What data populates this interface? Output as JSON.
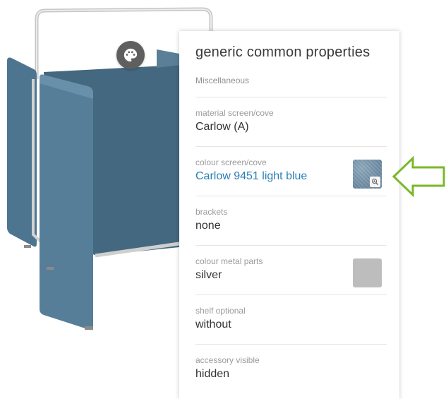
{
  "panel": {
    "title": "generic common properties",
    "section": "Miscellaneous",
    "properties": [
      {
        "label": "material screen/cove",
        "value": "Carlow (A)"
      },
      {
        "label": "colour screen/cove",
        "value": "Carlow 9451 light blue",
        "swatch_color": "#7a95ab"
      },
      {
        "label": "brackets",
        "value": "none"
      },
      {
        "label": "colour metal parts",
        "value": "silver",
        "swatch_color": "#bdbdbd"
      },
      {
        "label": "shelf optional",
        "value": "without"
      },
      {
        "label": "accessory visible",
        "value": "hidden"
      }
    ]
  },
  "colors": {
    "accent_link": "#2a7fb3",
    "screen_fabric": "#4d7490",
    "arrow_outline": "#7ab82a"
  },
  "icons": {
    "palette_button": "palette-icon",
    "swatch_zoom": "magnifier-icon",
    "annotation": "arrow-left-icon"
  }
}
